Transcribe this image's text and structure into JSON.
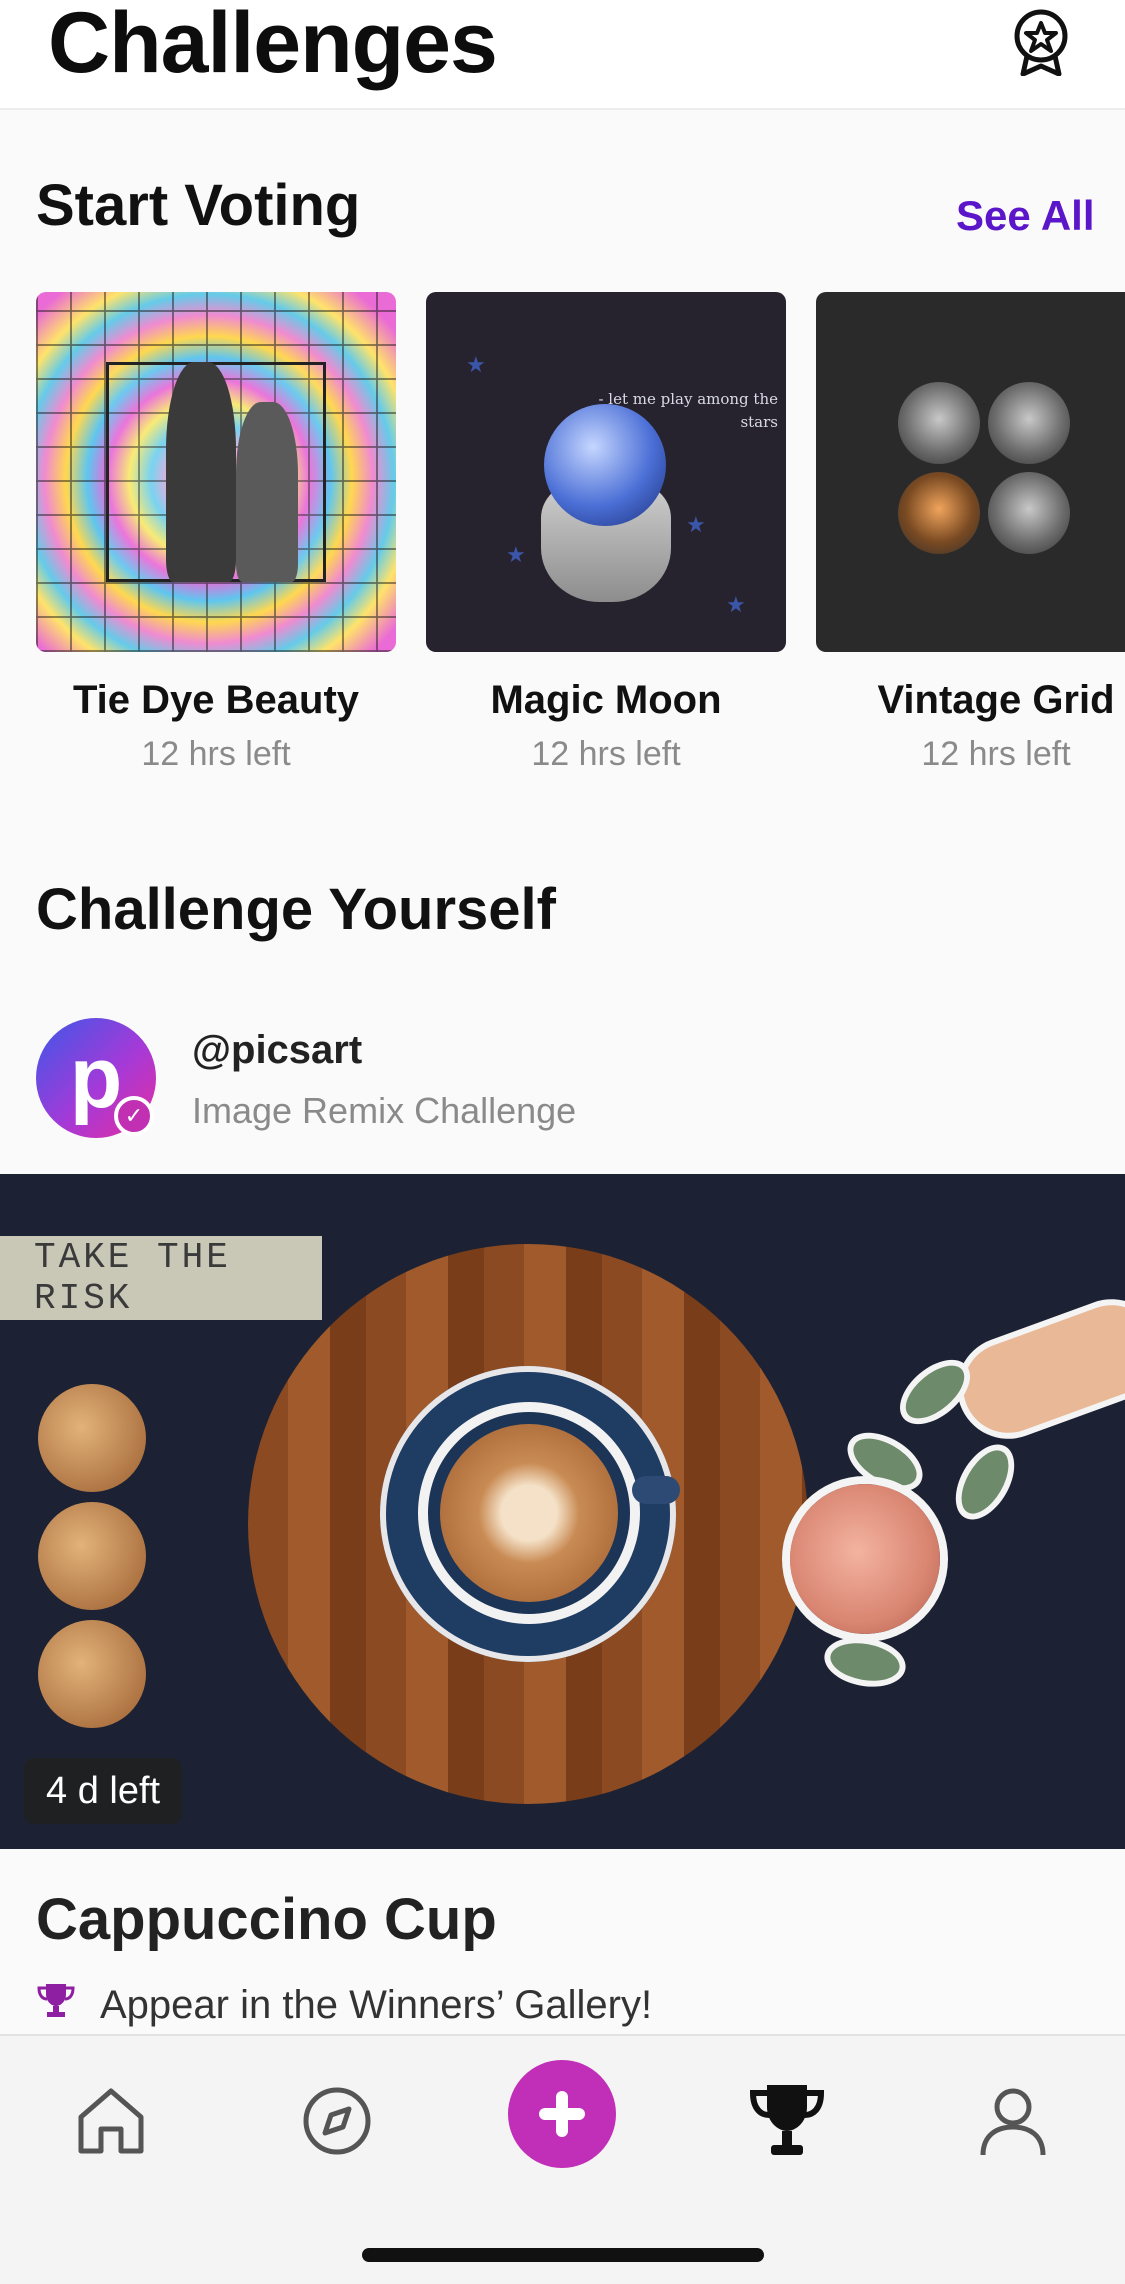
{
  "header": {
    "title": "Challenges",
    "badge_icon": "award-star-icon"
  },
  "start_voting": {
    "title": "Start Voting",
    "see_all": "See All",
    "cards": [
      {
        "title": "Tie Dye Beauty",
        "subtitle": "12 hrs left"
      },
      {
        "title": "Magic Moon",
        "subtitle": "12 hrs left",
        "image_text": "- let me play among the stars"
      },
      {
        "title": "Vintage Grid",
        "subtitle": "12 hrs left"
      }
    ]
  },
  "challenge_yourself": {
    "title": "Challenge Yourself",
    "avatar_letter": "p",
    "handle": "@picsart",
    "subtitle": "Image Remix Challenge",
    "hero": {
      "tape_text": "TAKE THE RISK",
      "time_left": "4 d left",
      "title": "Cappuccino Cup",
      "prize": "Appear in the Winners’ Gallery!"
    }
  },
  "bottom_nav": {
    "items": [
      "home-icon",
      "compass-icon",
      "plus-icon",
      "trophy-icon",
      "profile-icon"
    ]
  },
  "colors": {
    "accent": "#5b16c9",
    "brand": "#c12fb8"
  }
}
